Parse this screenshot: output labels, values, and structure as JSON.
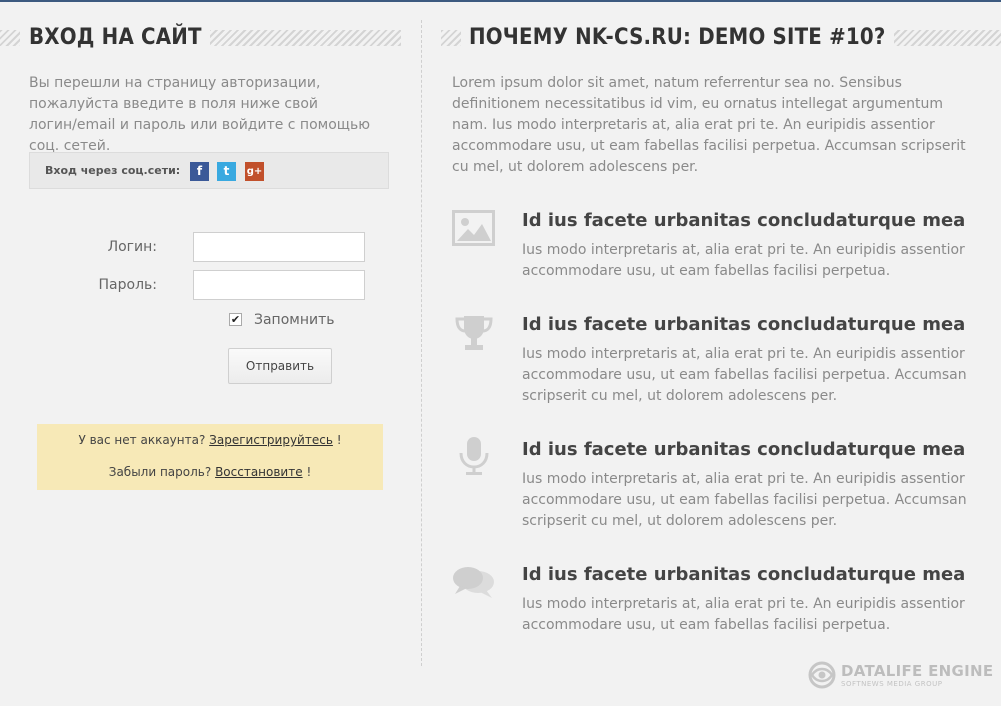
{
  "login": {
    "title": "ВХОД НА САЙТ",
    "intro": "Вы перешли на страницу авторизации, пожалуйста введите в поля ниже свой логин/email и пароль или войдите с помощью соц. сетей.",
    "social_label": "Вход через соц.сети:",
    "social": [
      {
        "name": "facebook",
        "glyph": "f",
        "color": "#3b5998"
      },
      {
        "name": "twitter",
        "glyph": "t",
        "color": "#39a9e0"
      },
      {
        "name": "google-plus",
        "glyph": "g+",
        "color": "#c1502b"
      }
    ],
    "login_label": "Логин:",
    "password_label": "Пароль:",
    "login_value": "",
    "password_value": "",
    "remember_label": "Запомнить",
    "remember_checked": true,
    "submit_label": "Отправить",
    "no_account_text": "У вас нет аккаунта?",
    "register_link": "Зарегистрируйтесь",
    "forgot_text": "Забыли пароль?",
    "restore_link": "Восстановите",
    "exclaim": "!",
    "notice_bg": "#f7e9b7"
  },
  "why": {
    "title": "ПОЧЕМУ NK-CS.RU: DEMO SITE #10?",
    "intro": "Lorem ipsum dolor sit amet, natum referrentur sea no. Sensibus definitionem necessitatibus id vim, eu ornatus intellegat argumentum nam. Ius modo interpretaris at, alia erat pri te. An euripidis assentior accommodare usu, ut eam fabellas facilisi perpetua. Accumsan scripserit cu mel, ut dolorem adolescens per.",
    "features": [
      {
        "icon": "image-icon",
        "title": "Id ius facete urbanitas concludaturque mea",
        "text": "Ius modo interpretaris at, alia erat pri te. An euripidis assentior accommodare usu, ut eam fabellas facilisi perpetua."
      },
      {
        "icon": "trophy-icon",
        "title": "Id ius facete urbanitas concludaturque mea",
        "text": "Ius modo interpretaris at, alia erat pri te. An euripidis assentior accommodare usu, ut eam fabellas facilisi perpetua. Accumsan scripserit cu mel, ut dolorem adolescens per."
      },
      {
        "icon": "microphone-icon",
        "title": "Id ius facete urbanitas concludaturque mea",
        "text": "Ius modo interpretaris at, alia erat pri te. An euripidis assentior accommodare usu, ut eam fabellas facilisi perpetua. Accumsan scripserit cu mel, ut dolorem adolescens per."
      },
      {
        "icon": "chat-bubbles-icon",
        "title": "Id ius facete urbanitas concludaturque mea",
        "text": "Ius modo interpretaris at, alia erat pri te. An euripidis assentior accommodare usu, ut eam fabellas facilisi perpetua."
      }
    ]
  },
  "brand": {
    "name": "DATALIFE ENGINE",
    "sub": "SOFTNEWS MEDIA GROUP"
  },
  "colors": {
    "background": "#f2f2f2",
    "top_accent": "#3d5a80",
    "icon_gray": "#cfcfcf"
  }
}
